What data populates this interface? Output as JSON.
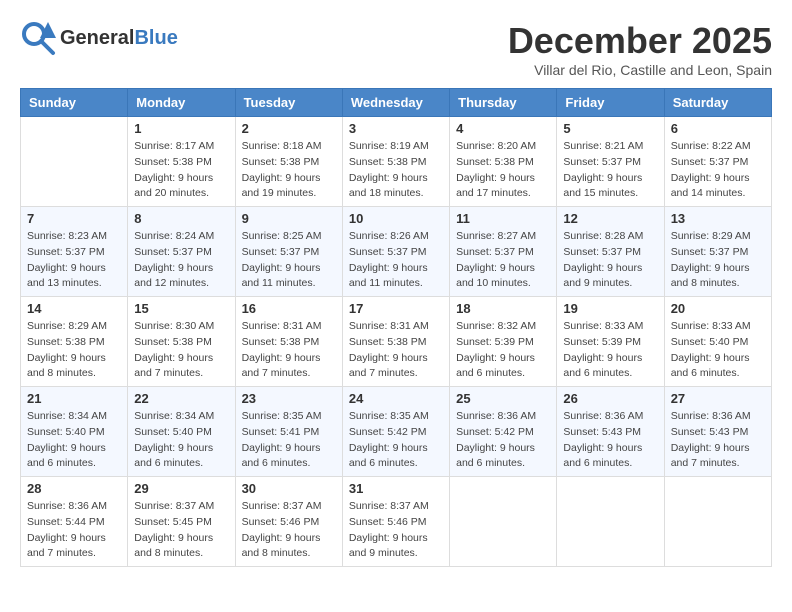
{
  "header": {
    "logo": {
      "general": "General",
      "blue": "Blue",
      "tagline": ""
    },
    "title": "December 2025",
    "location": "Villar del Rio, Castille and Leon, Spain"
  },
  "weekdays": [
    "Sunday",
    "Monday",
    "Tuesday",
    "Wednesday",
    "Thursday",
    "Friday",
    "Saturday"
  ],
  "weeks": [
    [
      {
        "day": "",
        "info": ""
      },
      {
        "day": "1",
        "info": "Sunrise: 8:17 AM\nSunset: 5:38 PM\nDaylight: 9 hours\nand 20 minutes."
      },
      {
        "day": "2",
        "info": "Sunrise: 8:18 AM\nSunset: 5:38 PM\nDaylight: 9 hours\nand 19 minutes."
      },
      {
        "day": "3",
        "info": "Sunrise: 8:19 AM\nSunset: 5:38 PM\nDaylight: 9 hours\nand 18 minutes."
      },
      {
        "day": "4",
        "info": "Sunrise: 8:20 AM\nSunset: 5:38 PM\nDaylight: 9 hours\nand 17 minutes."
      },
      {
        "day": "5",
        "info": "Sunrise: 8:21 AM\nSunset: 5:37 PM\nDaylight: 9 hours\nand 15 minutes."
      },
      {
        "day": "6",
        "info": "Sunrise: 8:22 AM\nSunset: 5:37 PM\nDaylight: 9 hours\nand 14 minutes."
      }
    ],
    [
      {
        "day": "7",
        "info": "Sunrise: 8:23 AM\nSunset: 5:37 PM\nDaylight: 9 hours\nand 13 minutes."
      },
      {
        "day": "8",
        "info": "Sunrise: 8:24 AM\nSunset: 5:37 PM\nDaylight: 9 hours\nand 12 minutes."
      },
      {
        "day": "9",
        "info": "Sunrise: 8:25 AM\nSunset: 5:37 PM\nDaylight: 9 hours\nand 11 minutes."
      },
      {
        "day": "10",
        "info": "Sunrise: 8:26 AM\nSunset: 5:37 PM\nDaylight: 9 hours\nand 11 minutes."
      },
      {
        "day": "11",
        "info": "Sunrise: 8:27 AM\nSunset: 5:37 PM\nDaylight: 9 hours\nand 10 minutes."
      },
      {
        "day": "12",
        "info": "Sunrise: 8:28 AM\nSunset: 5:37 PM\nDaylight: 9 hours\nand 9 minutes."
      },
      {
        "day": "13",
        "info": "Sunrise: 8:29 AM\nSunset: 5:37 PM\nDaylight: 9 hours\nand 8 minutes."
      }
    ],
    [
      {
        "day": "14",
        "info": "Sunrise: 8:29 AM\nSunset: 5:38 PM\nDaylight: 9 hours\nand 8 minutes."
      },
      {
        "day": "15",
        "info": "Sunrise: 8:30 AM\nSunset: 5:38 PM\nDaylight: 9 hours\nand 7 minutes."
      },
      {
        "day": "16",
        "info": "Sunrise: 8:31 AM\nSunset: 5:38 PM\nDaylight: 9 hours\nand 7 minutes."
      },
      {
        "day": "17",
        "info": "Sunrise: 8:31 AM\nSunset: 5:38 PM\nDaylight: 9 hours\nand 7 minutes."
      },
      {
        "day": "18",
        "info": "Sunrise: 8:32 AM\nSunset: 5:39 PM\nDaylight: 9 hours\nand 6 minutes."
      },
      {
        "day": "19",
        "info": "Sunrise: 8:33 AM\nSunset: 5:39 PM\nDaylight: 9 hours\nand 6 minutes."
      },
      {
        "day": "20",
        "info": "Sunrise: 8:33 AM\nSunset: 5:40 PM\nDaylight: 9 hours\nand 6 minutes."
      }
    ],
    [
      {
        "day": "21",
        "info": "Sunrise: 8:34 AM\nSunset: 5:40 PM\nDaylight: 9 hours\nand 6 minutes."
      },
      {
        "day": "22",
        "info": "Sunrise: 8:34 AM\nSunset: 5:40 PM\nDaylight: 9 hours\nand 6 minutes."
      },
      {
        "day": "23",
        "info": "Sunrise: 8:35 AM\nSunset: 5:41 PM\nDaylight: 9 hours\nand 6 minutes."
      },
      {
        "day": "24",
        "info": "Sunrise: 8:35 AM\nSunset: 5:42 PM\nDaylight: 9 hours\nand 6 minutes."
      },
      {
        "day": "25",
        "info": "Sunrise: 8:36 AM\nSunset: 5:42 PM\nDaylight: 9 hours\nand 6 minutes."
      },
      {
        "day": "26",
        "info": "Sunrise: 8:36 AM\nSunset: 5:43 PM\nDaylight: 9 hours\nand 6 minutes."
      },
      {
        "day": "27",
        "info": "Sunrise: 8:36 AM\nSunset: 5:43 PM\nDaylight: 9 hours\nand 7 minutes."
      }
    ],
    [
      {
        "day": "28",
        "info": "Sunrise: 8:36 AM\nSunset: 5:44 PM\nDaylight: 9 hours\nand 7 minutes."
      },
      {
        "day": "29",
        "info": "Sunrise: 8:37 AM\nSunset: 5:45 PM\nDaylight: 9 hours\nand 8 minutes."
      },
      {
        "day": "30",
        "info": "Sunrise: 8:37 AM\nSunset: 5:46 PM\nDaylight: 9 hours\nand 8 minutes."
      },
      {
        "day": "31",
        "info": "Sunrise: 8:37 AM\nSunset: 5:46 PM\nDaylight: 9 hours\nand 9 minutes."
      },
      {
        "day": "",
        "info": ""
      },
      {
        "day": "",
        "info": ""
      },
      {
        "day": "",
        "info": ""
      }
    ]
  ]
}
